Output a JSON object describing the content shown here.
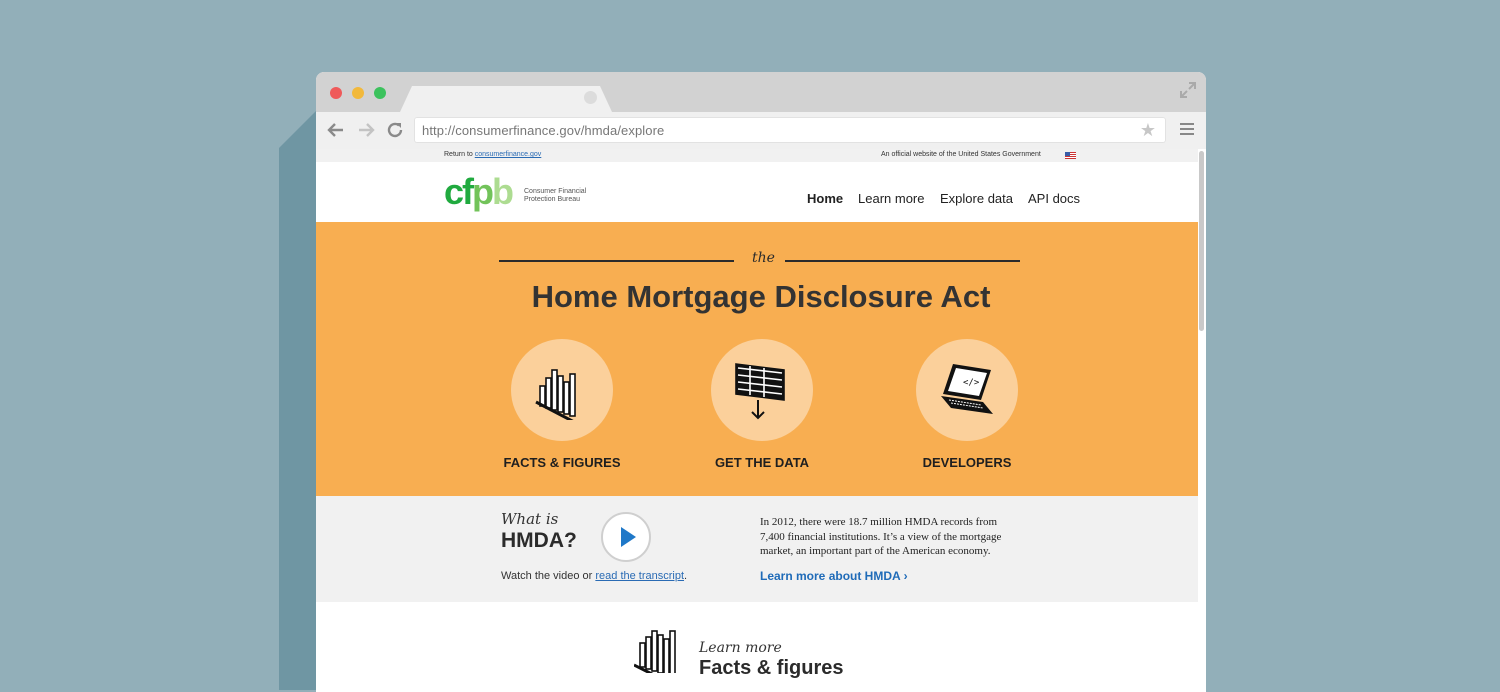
{
  "browser": {
    "url": "http://consumerfinance.gov/hmda/explore"
  },
  "gov_bar": {
    "return_prefix": "Return to",
    "return_link": "consumerfinance.gov",
    "official": "An official website of the United States Government"
  },
  "header": {
    "logo_letters": [
      "c",
      "f",
      "p",
      "b"
    ],
    "logo_text": "Consumer Financial Protection Bureau",
    "nav": [
      "Home",
      "Learn more",
      "Explore data",
      "API docs"
    ],
    "active_nav": "Home"
  },
  "hero": {
    "kicker": "the",
    "title": "Home Mortgage Disclosure Act",
    "features": [
      {
        "label": "FACTS & FIGURES",
        "icon": "bar-chart-icon"
      },
      {
        "label": "GET THE DATA",
        "icon": "data-table-download-icon"
      },
      {
        "label": "DEVELOPERS",
        "icon": "laptop-code-icon"
      }
    ]
  },
  "video": {
    "what_is": "What is",
    "hmda": "HMDA?",
    "watch_prefix": "Watch the video or",
    "transcript_link": "read the transcript",
    "watch_suffix": ".",
    "stats": "In 2012, there were 18.7 million HMDA records from 7,400 financial institutions. It’s a view of the mortgage market, an important part of the American economy.",
    "learn_more": "Learn more about HMDA ›"
  },
  "lower": {
    "kicker": "Learn more",
    "title": "Facts & figures"
  },
  "colors": {
    "background": "#92afb9",
    "hero": "#f8ae51",
    "circle": "#fbd09b",
    "link": "#1f6bb8",
    "logo_green": "#20aa3f"
  }
}
